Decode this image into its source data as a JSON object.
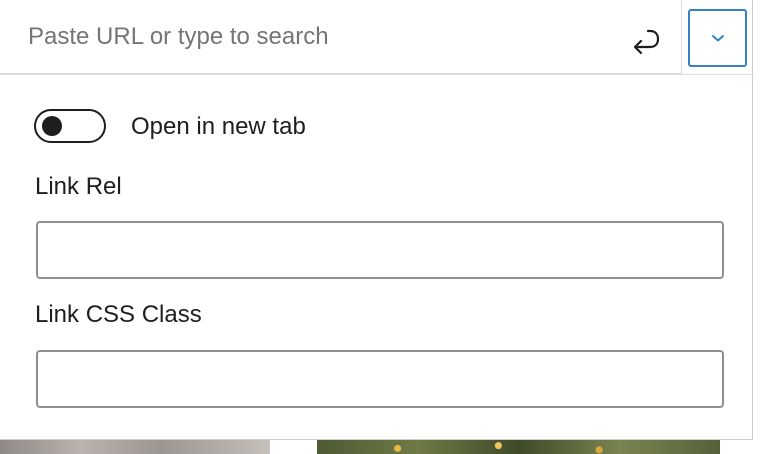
{
  "link_control": {
    "search": {
      "placeholder": "Paste URL or type to search",
      "value": ""
    },
    "submit_icon": "enter-return-icon",
    "settings_toggle_icon": "chevron-down-icon",
    "accent_color": "#3582c4"
  },
  "settings": {
    "open_in_new_tab": {
      "label": "Open in new tab",
      "checked": false
    },
    "link_rel": {
      "label": "Link Rel",
      "value": ""
    },
    "link_css_class": {
      "label": "Link CSS Class",
      "value": ""
    }
  }
}
